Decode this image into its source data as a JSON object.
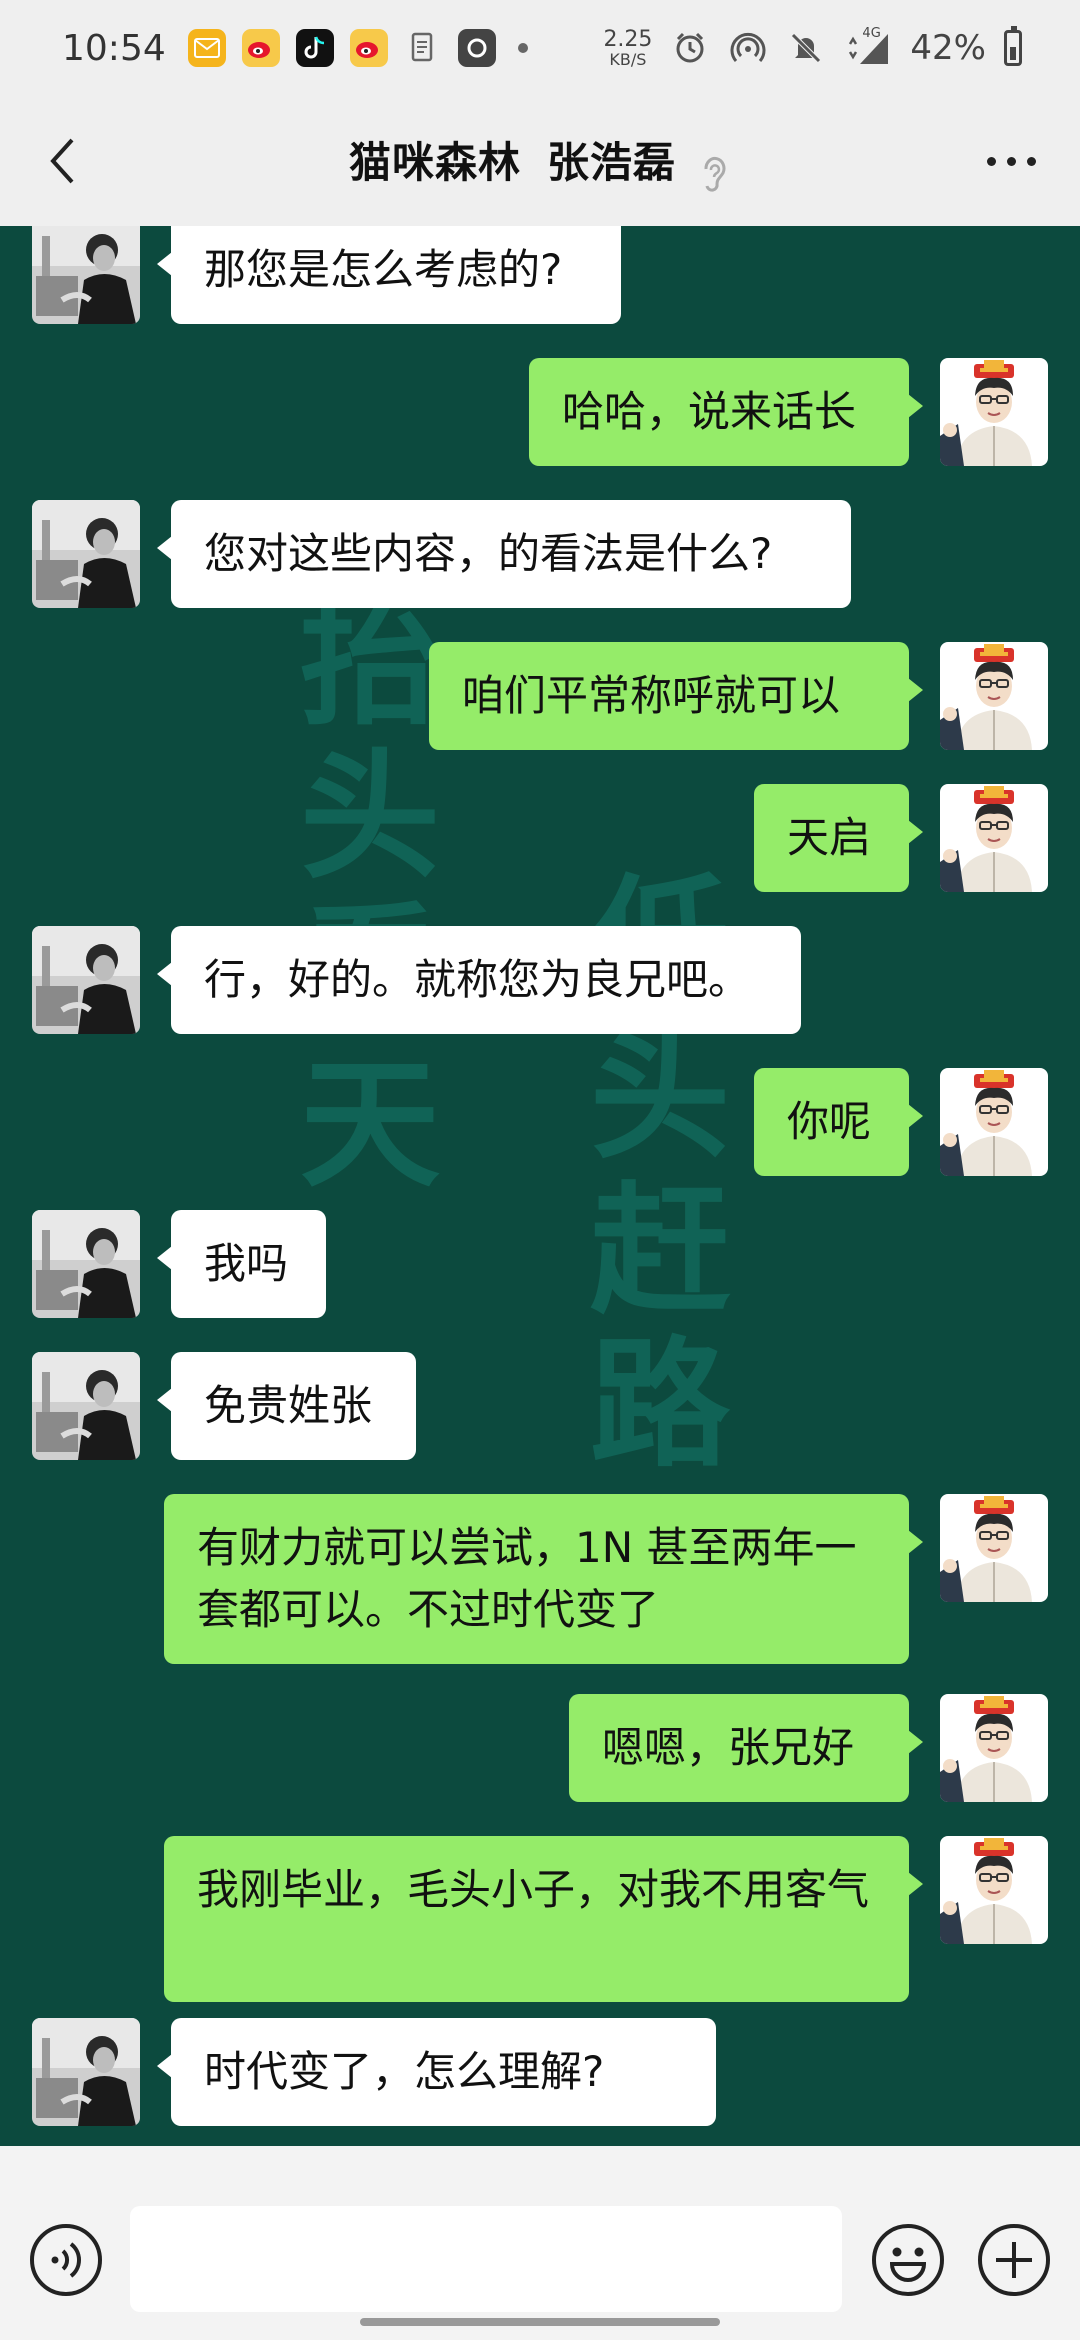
{
  "status_bar": {
    "time": "10:54",
    "net_speed_value": "2.25",
    "net_speed_unit": "KB/S",
    "network_type": "4G",
    "battery_percent": "42%",
    "icons": [
      "mail-icon",
      "weibo-icon",
      "tiktok-icon",
      "weibo-icon",
      "document-icon",
      "app-icon",
      "dot-icon",
      "alarm-icon",
      "hotspot-icon",
      "mute-icon",
      "signal-icon",
      "battery-icon"
    ]
  },
  "header": {
    "title_part1": "猫咪森林",
    "title_part2": "张浩磊",
    "icons": [
      "back-icon",
      "ear-icon",
      "more-icon"
    ]
  },
  "wallpaper": {
    "chars_left": "抬头看天",
    "chars_right": "低头赶路"
  },
  "messages": [
    {
      "side": "in",
      "text": "那您是怎么考虑的?"
    },
    {
      "side": "out",
      "text": "哈哈，说来话长"
    },
    {
      "side": "in",
      "text": "您对这些内容，的看法是什么?"
    },
    {
      "side": "out",
      "text": "咱们平常称呼就可以"
    },
    {
      "side": "out",
      "text": "天启"
    },
    {
      "side": "in",
      "text": "行，好的。就称您为良兄吧。"
    },
    {
      "side": "out",
      "text": "你呢"
    },
    {
      "side": "in",
      "text": "我吗"
    },
    {
      "side": "in",
      "text": "免贵姓张"
    },
    {
      "side": "out",
      "text": "有财力就可以尝试，1N 甚至两年一套都可以。不过时代变了"
    },
    {
      "side": "out",
      "text": "嗯嗯，张兄好"
    },
    {
      "side": "out",
      "text": "我刚毕业，毛头小子，对我不用客气"
    },
    {
      "side": "in",
      "text": "时代变了，怎么理解?"
    }
  ],
  "input_bar": {
    "value": "",
    "icons": [
      "voice-icon",
      "emoji-icon",
      "plus-icon"
    ]
  },
  "colors": {
    "chat_background": "#0c4a3e",
    "outgoing_bubble": "#95ec69",
    "incoming_bubble": "#ffffff",
    "header_background": "#efefef"
  }
}
